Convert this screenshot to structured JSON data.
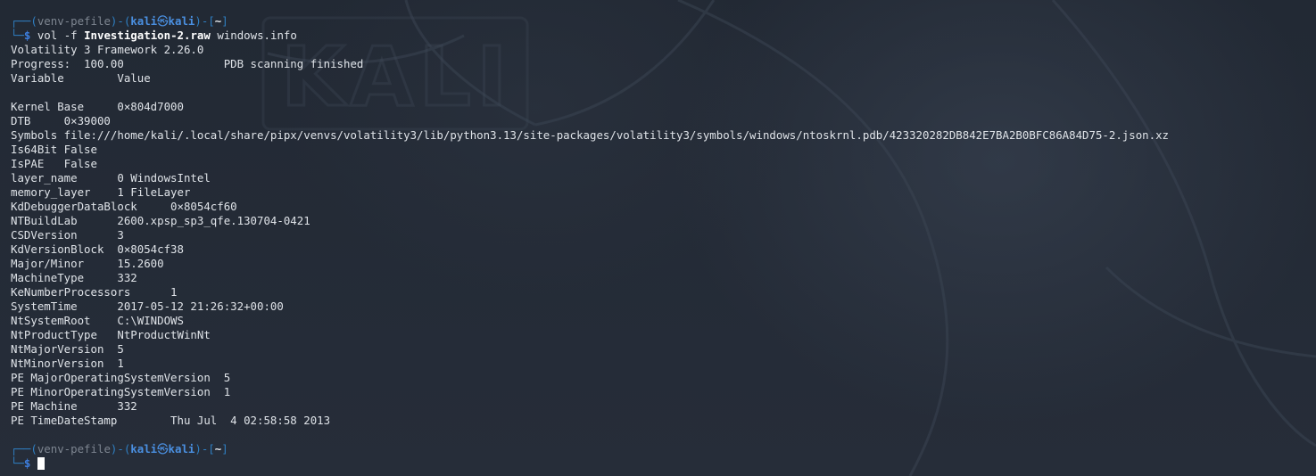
{
  "prompt": {
    "venv": "venv-pefile",
    "user": "kali",
    "host": "kali",
    "cwd": "~"
  },
  "command": {
    "cmd": "vol",
    "flag": "-f",
    "file": "Investigation-2.raw",
    "plugin": "windows.info"
  },
  "output": [
    "Volatility 3 Framework 2.26.0",
    "Progress:  100.00               PDB scanning finished",
    "Variable        Value",
    "",
    "Kernel Base     0×804d7000",
    "DTB     0×39000",
    "Symbols file:///home/kali/.local/share/pipx/venvs/volatility3/lib/python3.13/site-packages/volatility3/symbols/windows/ntoskrnl.pdb/423320282DB842E7BA2B0BFC86A84D75-2.json.xz",
    "Is64Bit False",
    "IsPAE   False",
    "layer_name      0 WindowsIntel",
    "memory_layer    1 FileLayer",
    "KdDebuggerDataBlock     0×8054cf60",
    "NTBuildLab      2600.xpsp_sp3_qfe.130704-0421",
    "CSDVersion      3",
    "KdVersionBlock  0×8054cf38",
    "Major/Minor     15.2600",
    "MachineType     332",
    "KeNumberProcessors      1",
    "SystemTime      2017-05-12 21:26:32+00:00",
    "NtSystemRoot    C:\\WINDOWS",
    "NtProductType   NtProductWinNt",
    "NtMajorVersion  5",
    "NtMinorVersion  1",
    "PE MajorOperatingSystemVersion  5",
    "PE MinorOperatingSystemVersion  1",
    "PE Machine      332",
    "PE TimeDateStamp        Thu Jul  4 02:58:58 2013",
    ""
  ],
  "wallpaper": {
    "logo_text": "KALI"
  },
  "colors": {
    "background": "#242b36",
    "prompt_frame": "#2f7fc2",
    "prompt_user": "#4a8fe0",
    "text": "#dfe3e8"
  }
}
